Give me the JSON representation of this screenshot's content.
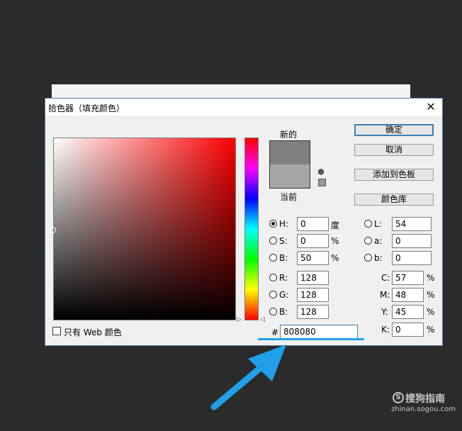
{
  "dialog": {
    "title": "拾色器（填充颜色）",
    "close_glyph": "✕"
  },
  "swatches": {
    "new_label": "新的",
    "current_label": "当前",
    "new_color": "#808080",
    "current_color": "#a6a6a6"
  },
  "buttons": {
    "ok": "确定",
    "cancel": "取消",
    "add_to_swatches": "添加到色板",
    "color_libraries": "颜色库"
  },
  "hsb": {
    "h_label": "H:",
    "h_value": "0",
    "h_unit": "度",
    "s_label": "S:",
    "s_value": "0",
    "s_unit": "%",
    "b_label": "B:",
    "b_value": "50",
    "b_unit": "%"
  },
  "rgb": {
    "r_label": "R:",
    "r_value": "128",
    "g_label": "G:",
    "g_value": "128",
    "b_label": "B:",
    "b_value": "128"
  },
  "lab": {
    "l_label": "L:",
    "l_value": "54",
    "a_label": "a:",
    "a_value": "0",
    "b_label": "b:",
    "b_value": "0"
  },
  "cmyk": {
    "c_label": "C:",
    "c_value": "57",
    "m_label": "M:",
    "m_value": "48",
    "y_label": "Y:",
    "y_value": "45",
    "k_label": "K:",
    "k_value": "0",
    "unit": "%"
  },
  "hex": {
    "hash": "#",
    "value": "808080"
  },
  "web_only_label": "只有 Web 颜色",
  "selected_radio": "H",
  "annotation": {
    "accent_color": "#1fa0e8"
  },
  "watermark": {
    "logo_glyph": "S",
    "brand": "搜狗指南",
    "url": "zhinan.sogou.com"
  }
}
